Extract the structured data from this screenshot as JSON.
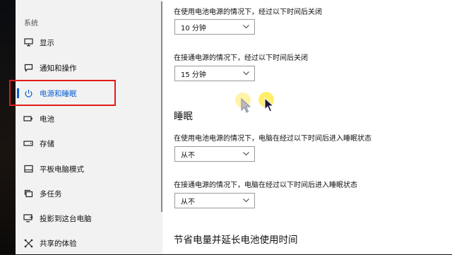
{
  "sidebar": {
    "section": "系统",
    "items": [
      {
        "label": "显示",
        "icon": "monitor-icon"
      },
      {
        "label": "通知和操作",
        "icon": "chat-bubble-icon"
      },
      {
        "label": "电源和睡眠",
        "icon": "power-icon",
        "active": true
      },
      {
        "label": "电池",
        "icon": "battery-icon"
      },
      {
        "label": "存储",
        "icon": "storage-drive-icon"
      },
      {
        "label": "平板电脑模式",
        "icon": "tablet-mode-icon"
      },
      {
        "label": "多任务",
        "icon": "multitask-icon"
      },
      {
        "label": "投影到这台电脑",
        "icon": "project-to-pc-icon"
      },
      {
        "label": "共享的体验",
        "icon": "shared-experience-icon"
      }
    ],
    "accent_color": "#0a60d0",
    "highlight_color": "#e11b1b"
  },
  "screen": {
    "battery_label": "在使用电池电源的情况下，经过以下时间后关闭",
    "battery_value": "10 分钟",
    "plugged_label": "在接通电源的情况下，经过以下时间后关闭",
    "plugged_value": "15 分钟"
  },
  "sleep": {
    "heading": "睡眠",
    "battery_label": "在使用电池电源的情况下，电脑在经过以下时间后进入睡眠状态",
    "battery_value": "从不",
    "plugged_label": "在接通电源的情况下，电脑在经过以下时间后进入睡眠状态",
    "plugged_value": "从不"
  },
  "save_power": {
    "heading": "节省电量并延长电池使用时间"
  }
}
